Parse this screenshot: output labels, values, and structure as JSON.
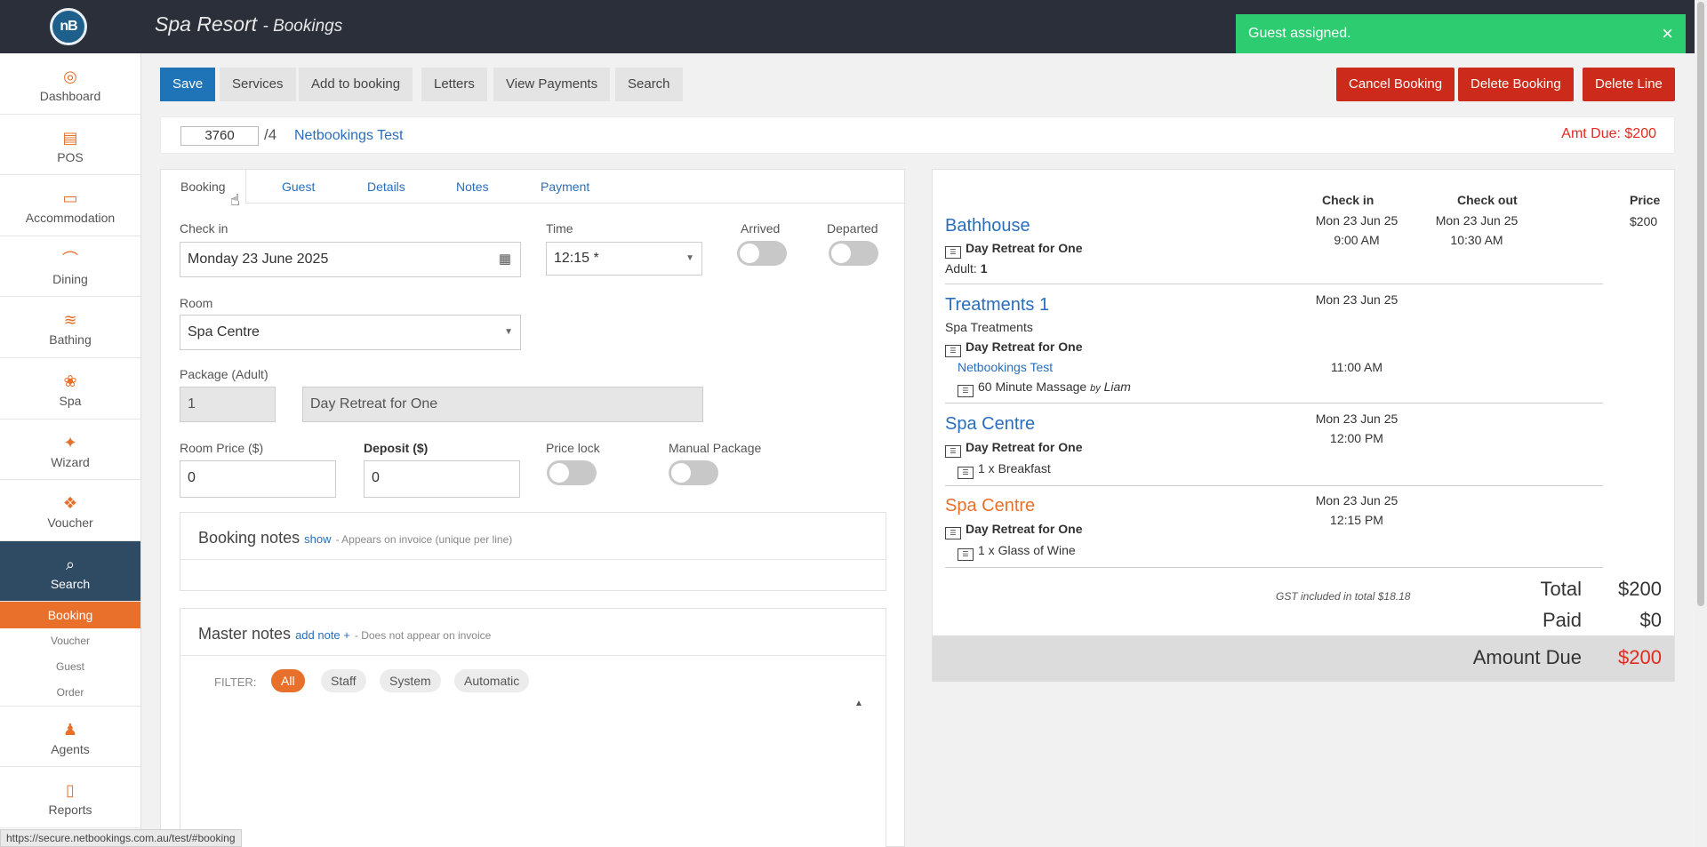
{
  "app": {
    "logo": "nB",
    "title": "Spa Resort",
    "subtitle": "Bookings"
  },
  "toast": {
    "message": "Guest assigned.",
    "close": "×"
  },
  "sidebar": {
    "items": [
      {
        "label": "Dashboard",
        "icon": "◎"
      },
      {
        "label": "POS",
        "icon": "▤"
      },
      {
        "label": "Accommodation",
        "icon": "▭"
      },
      {
        "label": "Dining",
        "icon": "⌒"
      },
      {
        "label": "Bathing",
        "icon": "≋"
      },
      {
        "label": "Spa",
        "icon": "❀"
      },
      {
        "label": "Wizard",
        "icon": "✦"
      },
      {
        "label": "Voucher",
        "icon": "❖"
      },
      {
        "label": "Search",
        "icon": "⌕"
      }
    ],
    "sub": [
      "Booking",
      "Voucher",
      "Guest",
      "Order"
    ],
    "bottom": [
      {
        "label": "Agents",
        "icon": "♟"
      },
      {
        "label": "Reports",
        "icon": "▯"
      }
    ]
  },
  "toolbar": {
    "save": "Save",
    "services": "Services",
    "add_to_booking": "Add to booking",
    "letters": "Letters",
    "view_payments": "View Payments",
    "search": "Search",
    "cancel_booking": "Cancel Booking",
    "delete_booking": "Delete Booking",
    "delete_line": "Delete Line"
  },
  "booking": {
    "number": "3760",
    "line": "/4",
    "name": "Netbookings Test",
    "amt_due": "Amt Due: $200"
  },
  "tabs": [
    "Booking",
    "Guest",
    "Details",
    "Notes",
    "Payment"
  ],
  "form": {
    "checkin_label": "Check in",
    "checkin_value": "Monday 23 June 2025",
    "time_label": "Time",
    "time_value": "12:15 *",
    "arrived_label": "Arrived",
    "departed_label": "Departed",
    "room_label": "Room",
    "room_value": "Spa Centre",
    "package_label": "Package (Adult)",
    "package_qty": "1",
    "package_name": "Day Retreat for One",
    "room_price_label": "Room Price ($)",
    "room_price_value": "0",
    "deposit_label": "Deposit ($)",
    "deposit_value": "0",
    "price_lock_label": "Price lock",
    "manual_package_label": "Manual Package"
  },
  "booking_notes": {
    "title": "Booking notes",
    "link": "show",
    "hint": "- Appears on invoice (unique per line)"
  },
  "master_notes": {
    "title": "Master notes",
    "link": "add note +",
    "hint": "- Does not appear on invoice",
    "filter_label": "FILTER:",
    "filters": [
      "All",
      "Staff",
      "System",
      "Automatic"
    ]
  },
  "summary": {
    "headers": {
      "checkin": "Check in",
      "checkout": "Check out",
      "price": "Price"
    },
    "lines": [
      {
        "title": "Bathhouse",
        "package": "Day Retreat for One",
        "adult_label": "Adult:",
        "adult_value": "1",
        "checkin_date": "Mon 23 Jun 25",
        "checkin_time": "9:00 AM",
        "checkout_date": "Mon 23 Jun 25",
        "checkout_time": "10:30 AM",
        "price": "$200"
      },
      {
        "title": "Treatments 1",
        "subtitle": "Spa Treatments",
        "package": "Day Retreat for One",
        "guest": "Netbookings Test",
        "item": "60 Minute Massage",
        "by": "by",
        "therapist": "Liam",
        "checkin_date": "Mon 23 Jun 25",
        "item_time": "11:00 AM"
      },
      {
        "title": "Spa Centre",
        "package": "Day Retreat for One",
        "item": "1 x Breakfast",
        "checkin_date": "Mon 23 Jun 25",
        "checkin_time": "12:00 PM"
      },
      {
        "title": "Spa Centre",
        "package": "Day Retreat for One",
        "item": "1 x Glass of Wine",
        "checkin_date": "Mon 23 Jun 25",
        "checkin_time": "12:15 PM"
      }
    ],
    "gst": "GST included in total $18.18",
    "total_label": "Total",
    "total_value": "$200",
    "paid_label": "Paid",
    "paid_value": "$0",
    "due_label": "Amount Due",
    "due_value": "$200"
  },
  "statusbar": "https://secure.netbookings.com.au/test/#booking",
  "colors": {
    "accent": "#e8702a",
    "primary": "#1f73b7",
    "danger": "#cc2a1a",
    "success": "#2ecc71",
    "link": "#2a6ebb"
  }
}
